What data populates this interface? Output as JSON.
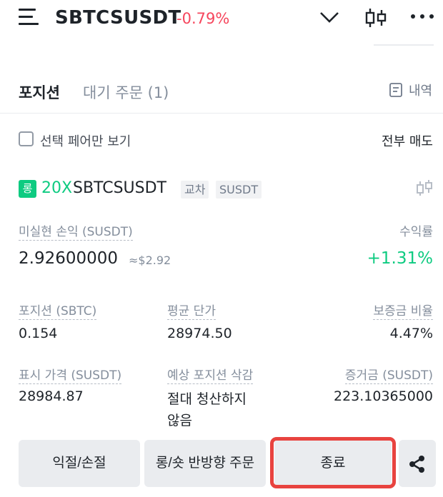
{
  "header": {
    "symbol": "SBTCSUSDT",
    "change": "-0.79%",
    "menu_icon": "hamburger-menu-icon",
    "dropdown_icon": "chevron-down-icon",
    "chart_icon": "candlestick-icon",
    "more_icon": "more-dots-icon"
  },
  "tabs": {
    "positions": "포지션",
    "open_orders": "대기 주문 (1)",
    "history": "내역"
  },
  "filter": {
    "only_pair": "선택 페어만 보기",
    "close_all": "전부 매도"
  },
  "position": {
    "side": "롱",
    "leverage": "20X",
    "symbol": "SBTCSUSDT",
    "margin_mode": "교차",
    "margin_asset": "SUSDT",
    "unrealized_pnl_label": "미실현 손익 (SUSDT)",
    "unrealized_pnl": "2.92600000",
    "unrealized_pnl_usd": "≈$2.92",
    "roe_label": "수익률",
    "roe": "+1.31%",
    "size_label": "포지션 (SBTC)",
    "size": "0.154",
    "entry_price_label": "평균 단가",
    "entry_price": "28974.50",
    "margin_ratio_label": "보증금 비율",
    "margin_ratio": "4.47%",
    "mark_price_label": "표시 가격 (SUSDT)",
    "mark_price": "28984.87",
    "liq_price_label": "예상 포지션 삭감",
    "liq_price_1": "절대 청산하지",
    "liq_price_2": "않음",
    "margin_label": "증거금 (SUSDT)",
    "margin": "223.10365000"
  },
  "actions": {
    "tp_sl": "익절/손절",
    "reverse": "롱/숏 반방향 주문",
    "close": "종료"
  },
  "colors": {
    "up": "#0ecb81",
    "down": "#f6465d",
    "highlight": "#e8433f"
  }
}
